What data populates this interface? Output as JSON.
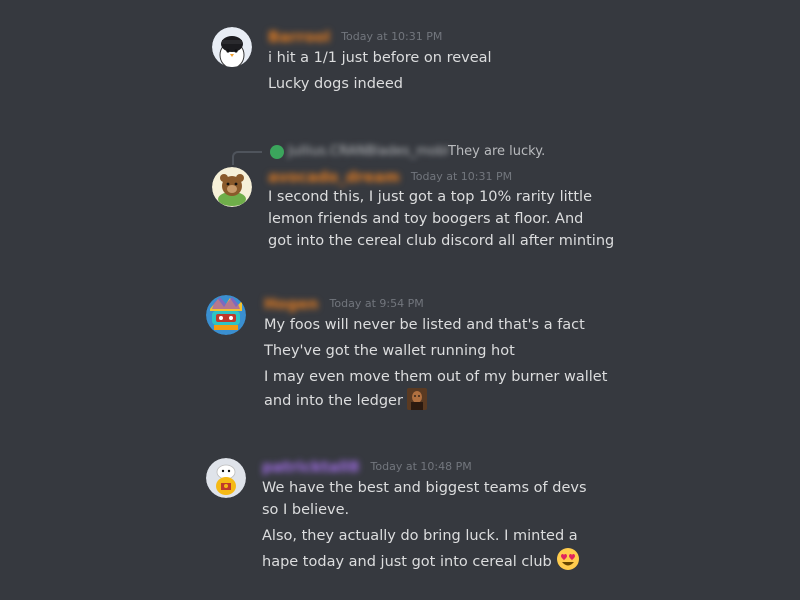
{
  "colors": {
    "background": "#36393f",
    "text": "#dcddde",
    "muted": "#72767d",
    "username_orange": "#e67e22",
    "username_purple": "#a16ee6"
  },
  "messages": [
    {
      "username": "Barrool",
      "username_color": "#e67e22",
      "timestamp": "Today at 10:31 PM",
      "avatar_icon": "penguin-hoodie-avatar",
      "lines": [
        "i hit a 1/1 just before on reveal",
        "Lucky dogs indeed"
      ]
    },
    {
      "reply": {
        "username": "Jullius.CRANBlades_mobl",
        "text": "They are lucky.",
        "icon": "green-frog-icon"
      },
      "username": "avocado_dream",
      "username_color": "#e67e22",
      "timestamp": "Today at 10:31 PM",
      "avatar_icon": "bear-avatar",
      "lines": [
        "I second this, I just got a top 10% rarity little",
        "lemon friends and toy boogers at floor. And",
        "got into the cereal club discord all after minting"
      ]
    },
    {
      "username": "Hogen",
      "username_color": "#e67e22",
      "timestamp": "Today at 9:54 PM",
      "avatar_icon": "colorful-cartoon-avatar",
      "lines": [
        "My foos will never be listed and that's a fact",
        "They've got the wallet running hot",
        "I may even move them out of my burner wallet",
        "and into the ledger"
      ],
      "emoji": "person-emoji"
    },
    {
      "username": "patricktall8",
      "username_color": "#a16ee6",
      "timestamp": "Today at 10:48 PM",
      "avatar_icon": "duck-avatar",
      "lines": [
        "We have the best and biggest teams of devs",
        "so I believe.",
        "Also, they actually do bring luck. I minted a",
        "hape today and just got into cereal club"
      ],
      "emoji": "heart-eyes-emoji"
    }
  ]
}
